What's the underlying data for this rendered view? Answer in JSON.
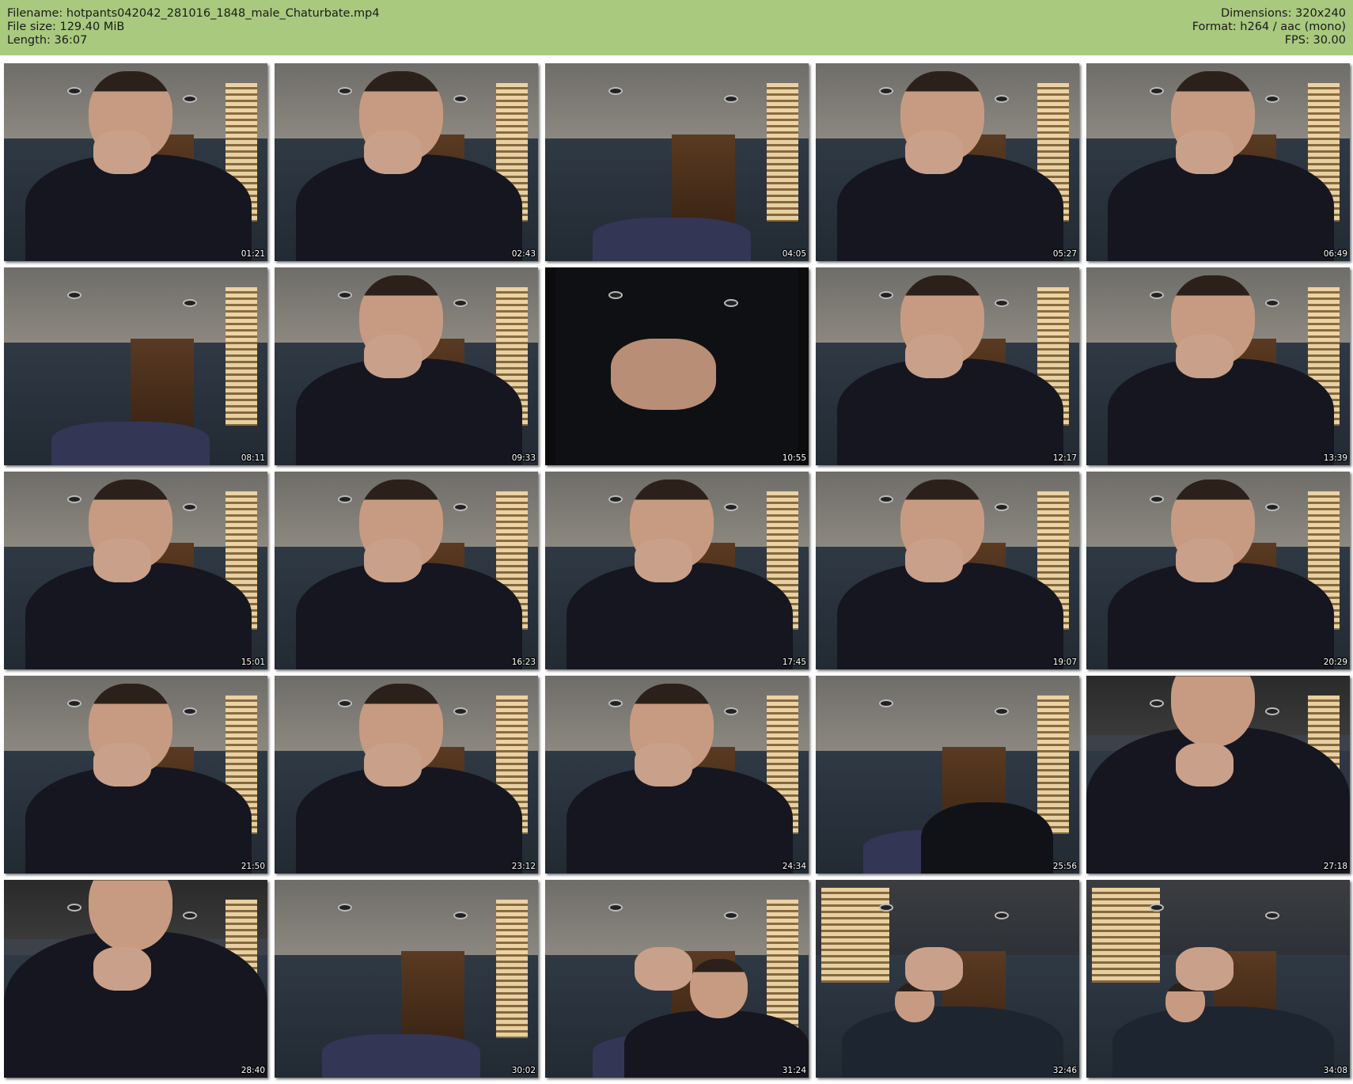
{
  "header": {
    "filename": "Filename: hotpants042042_281016_1848_male_Chaturbate.mp4",
    "filesize": "File size: 129.40 MiB",
    "length": "Length: 36:07",
    "dimensions": "Dimensions: 320x240",
    "format": "Format: h264 / aac (mono)",
    "fps": "FPS: 30.00"
  },
  "colors": {
    "header_background": "#a9c97f",
    "page_background": "#ffffff",
    "timestamp_text": "#ffffff"
  },
  "thumbnails": [
    {
      "time": "01:21",
      "scene": "person-hand-face"
    },
    {
      "time": "02:43",
      "scene": "person-hand-face"
    },
    {
      "time": "04:05",
      "scene": "room-empty"
    },
    {
      "time": "05:27",
      "scene": "person-face"
    },
    {
      "time": "06:49",
      "scene": "person-hand-face"
    },
    {
      "time": "08:11",
      "scene": "room-empty"
    },
    {
      "time": "09:33",
      "scene": "person-face"
    },
    {
      "time": "10:55",
      "scene": "hands-closeup"
    },
    {
      "time": "12:17",
      "scene": "person-face"
    },
    {
      "time": "13:39",
      "scene": "person-drinking"
    },
    {
      "time": "15:01",
      "scene": "person-hand-face"
    },
    {
      "time": "16:23",
      "scene": "person-hand-face"
    },
    {
      "time": "17:45",
      "scene": "person-face"
    },
    {
      "time": "19:07",
      "scene": "person-face"
    },
    {
      "time": "20:29",
      "scene": "person-hand-face"
    },
    {
      "time": "21:50",
      "scene": "person-face"
    },
    {
      "time": "23:12",
      "scene": "person-face"
    },
    {
      "time": "24:34",
      "scene": "person-face"
    },
    {
      "time": "25:56",
      "scene": "legs"
    },
    {
      "time": "27:18",
      "scene": "person-dark-close"
    },
    {
      "time": "28:40",
      "scene": "person-dark-close"
    },
    {
      "time": "30:02",
      "scene": "room-empty"
    },
    {
      "time": "31:24",
      "scene": "person-low"
    },
    {
      "time": "32:46",
      "scene": "person-couch"
    },
    {
      "time": "34:08",
      "scene": "person-couch"
    }
  ]
}
